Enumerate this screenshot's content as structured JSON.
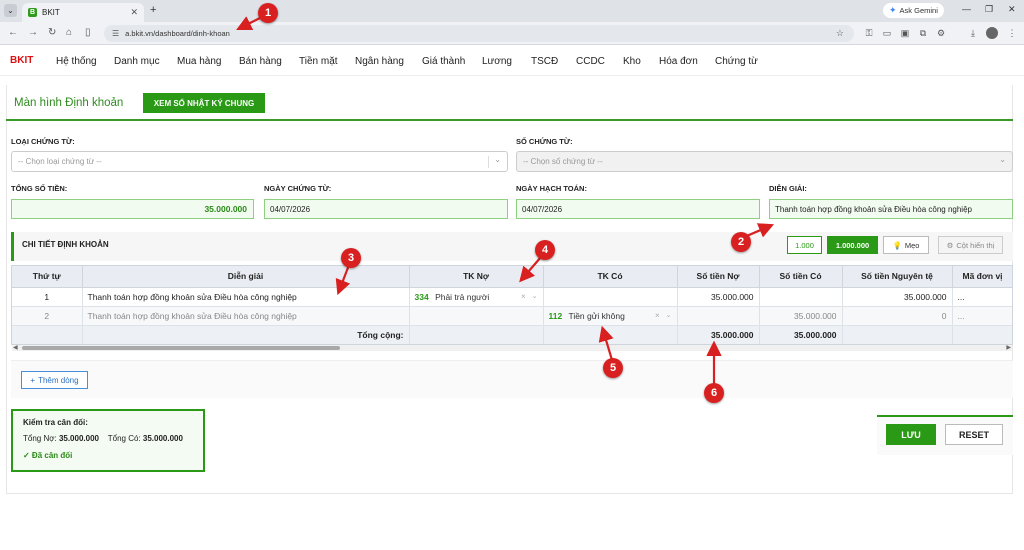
{
  "browser": {
    "tab_title": "BKIT",
    "tab_favicon": "B",
    "url": "a.bkit.vn/dashboard/dinh-khoan",
    "gemini_label": "Ask Gemini"
  },
  "nav": {
    "brand": "BKIT",
    "items": [
      "Hệ thống",
      "Danh mục",
      "Mua hàng",
      "Bán hàng",
      "Tiền mặt",
      "Ngân hàng",
      "Giá thành",
      "Lương",
      "TSCĐ",
      "CCDC",
      "Kho",
      "Hóa đơn",
      "Chứng từ"
    ]
  },
  "page": {
    "title": "Màn hình Định khoản",
    "journal_button": "XEM SỔ NHẬT KÝ CHUNG"
  },
  "form": {
    "voucher_type_label": "LOẠI CHỨNG TỪ:",
    "voucher_type_placeholder": "-- Chọn loại chứng từ --",
    "voucher_no_label": "SỐ CHỨNG TỪ:",
    "voucher_no_placeholder": "-- Chọn số chứng từ --",
    "total_label": "TỔNG SỐ TIỀN:",
    "total_value": "35.000.000",
    "voucher_date_label": "NGÀY CHỨNG TỪ:",
    "voucher_date_value": "04/07/2026",
    "posting_date_label": "NGÀY HẠCH TOÁN:",
    "posting_date_value": "04/07/2026",
    "description_label": "DIỄN GIẢI:",
    "description_value": "Thanh toán hợp đồng khoản sửa Điều hòa công nghiệp"
  },
  "section": {
    "title": "CHI TIẾT ĐỊNH KHOẢN",
    "unit_1": "1.000",
    "unit_2": "1.000.000",
    "tips": "Mẹo",
    "columns_button": "Cột hiển thị"
  },
  "table": {
    "headers": [
      "Thứ tự",
      "Diễn giải",
      "TK Nợ",
      "TK Có",
      "Số tiền Nợ",
      "Số tiền Có",
      "Số tiền Nguyên tệ",
      "Mã đơn vị"
    ],
    "rows": [
      {
        "order": "1",
        "desc": "Thanh toán hợp đồng khoản sửa Điều hòa công nghiệp",
        "debit_code": "334",
        "debit_name": "Phải trả người",
        "credit_code": "",
        "credit_name": "",
        "debit_amount": "35.000.000",
        "credit_amount": "",
        "foreign_amount": "35.000.000",
        "unit": "..."
      },
      {
        "order": "2",
        "desc": "Thanh toán hợp đồng khoản sửa Điều hòa công nghiệp",
        "debit_code": "",
        "debit_name": "",
        "credit_code": "112",
        "credit_name": "Tiền gửi không",
        "debit_amount": "",
        "credit_amount": "35.000.000",
        "foreign_amount": "0",
        "unit": "..."
      }
    ],
    "total_label": "Tổng cộng:",
    "total_debit": "35.000.000",
    "total_credit": "35.000.000"
  },
  "add_row_label": "Thêm dòng",
  "balance": {
    "title": "Kiểm tra cân đối:",
    "debit_label": "Tổng Nợ:",
    "debit_value": "35.000.000",
    "credit_label": "Tổng Có:",
    "credit_value": "35.000.000",
    "status": "✓ Đã cân đối"
  },
  "actions": {
    "save": "LƯU",
    "reset": "RESET"
  },
  "annotations": [
    "1",
    "2",
    "3",
    "4",
    "5",
    "6"
  ],
  "colors": {
    "accent": "#2a9a16",
    "marker": "#d82020",
    "brand": "#dd1111"
  }
}
